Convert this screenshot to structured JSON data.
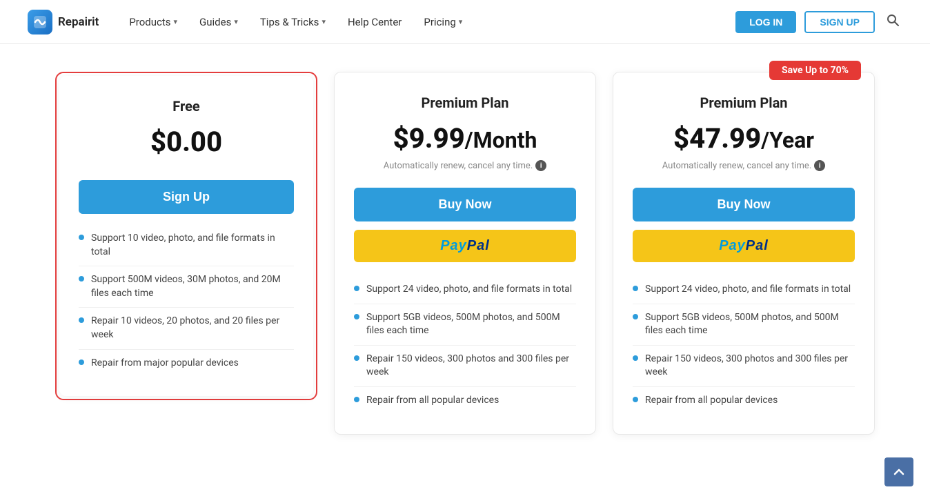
{
  "header": {
    "logo_text": "Repairit",
    "nav_items": [
      {
        "label": "Products",
        "has_dropdown": true
      },
      {
        "label": "Guides",
        "has_dropdown": true
      },
      {
        "label": "Tips & Tricks",
        "has_dropdown": true
      },
      {
        "label": "Help Center",
        "has_dropdown": false
      },
      {
        "label": "Pricing",
        "has_dropdown": true
      }
    ],
    "login_label": "LOG IN",
    "signup_label": "SIGN UP"
  },
  "pricing": {
    "save_badge": "Save Up to 70%",
    "cards": [
      {
        "id": "free",
        "title": "Free",
        "price": "$0.00",
        "period": "",
        "auto_renew": "",
        "cta_label": "Sign Up",
        "features": [
          "Support 10 video, photo, and file formats in total",
          "Support 500M videos, 30M photos, and 20M files each time",
          "Repair 10 videos, 20 photos, and 20 files per week",
          "Repair from major popular devices"
        ],
        "highlighted": true,
        "show_paypal": false
      },
      {
        "id": "premium-monthly",
        "title": "Premium Plan",
        "price": "$9.99",
        "period": "/Month",
        "auto_renew": "Automatically renew, cancel any time.",
        "cta_label": "Buy Now",
        "features": [
          "Support 24 video, photo, and file formats in total",
          "Support 5GB videos, 500M photos, and 500M files each time",
          "Repair 150 videos, 300 photos and 300 files per week",
          "Repair from all popular devices"
        ],
        "highlighted": false,
        "show_paypal": true
      },
      {
        "id": "premium-yearly",
        "title": "Premium Plan",
        "price": "$47.99",
        "period": "/Year",
        "auto_renew": "Automatically renew, cancel any time.",
        "cta_label": "Buy Now",
        "features": [
          "Support 24 video, photo, and file formats in total",
          "Support 5GB videos, 500M photos, and 500M files each time",
          "Repair 150 videos, 300 photos and 300 files per week",
          "Repair from all popular devices"
        ],
        "highlighted": false,
        "show_paypal": true,
        "has_badge": true
      }
    ]
  },
  "paypal_label": "PayPal"
}
